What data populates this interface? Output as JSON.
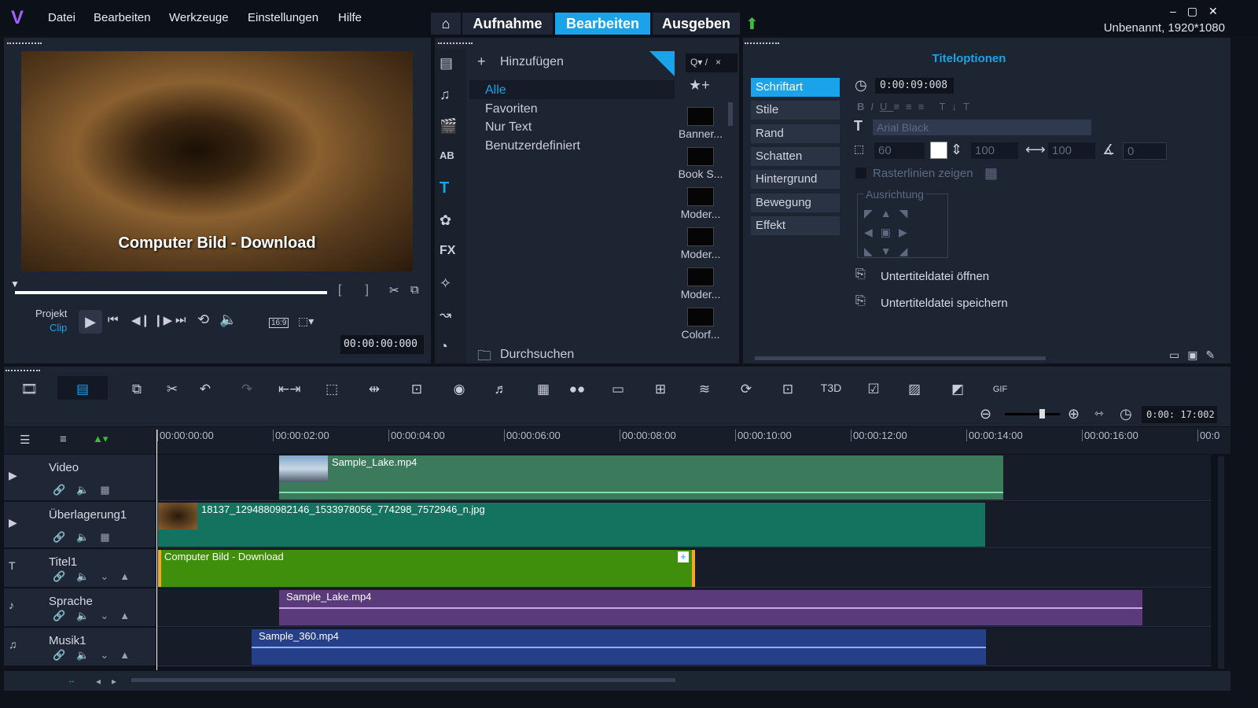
{
  "menubar": {
    "items": [
      "Datei",
      "Bearbeiten",
      "Werkzeuge",
      "Einstellungen",
      "Hilfe"
    ],
    "tabs": [
      "Aufnahme",
      "Bearbeiten",
      "Ausgeben"
    ],
    "active_tab": "Bearbeiten",
    "project_info": "Unbenannt, 1920*1080"
  },
  "preview": {
    "overlay_text": "Computer Bild - Download",
    "mode_project": "Projekt",
    "mode_clip": "Clip",
    "aspect": "16:9",
    "timecode": "00:00:00:000"
  },
  "library": {
    "add_label": "Hinzufügen",
    "filters": [
      "Alle",
      "Favoriten",
      "Nur Text",
      "Benutzerdefiniert"
    ],
    "selected_filter": "Alle",
    "browse_label": "Durchsuchen",
    "fx_label": "FX",
    "templates": [
      "Banner...",
      "Book S...",
      "Moder...",
      "Moder...",
      "Moder...",
      "Colorf..."
    ]
  },
  "title_options": {
    "heading": "Titeloptionen",
    "tabs": [
      "Schriftart",
      "Stile",
      "Rand",
      "Schatten",
      "Hintergrund",
      "Bewegung",
      "Effekt"
    ],
    "active_tab": "Schriftart",
    "duration": "0:00:09:008",
    "font": "Arial Black",
    "font_size": "60",
    "line_spacing": "100",
    "char_spacing": "100",
    "angle": "0",
    "grid_label": "Rasterlinien zeigen",
    "alignment_label": "Ausrichtung",
    "open_subtitle": "Untertiteldatei öffnen",
    "save_subtitle": "Untertiteldatei speichern",
    "accent": "#1aa3e8"
  },
  "timeline": {
    "duration": "0:00: 17:002",
    "ruler": [
      "00:00:00:00",
      "00:00:02:00",
      "00:00:04:00",
      "00:00:06:00",
      "00:00:08:00",
      "00:00:10:00",
      "00:00:12:00",
      "00:00:14:00",
      "00:00:16:00",
      "00:0"
    ],
    "tracks": [
      {
        "name": "Video"
      },
      {
        "name": "Überlagerung1"
      },
      {
        "name": "Titel1"
      },
      {
        "name": "Sprache"
      },
      {
        "name": "Musik1"
      }
    ],
    "clips": {
      "video": "Sample_Lake.mp4",
      "overlay": "18137_1294880982146_1533978056_774298_7572946_n.jpg",
      "title": "Computer Bild - Download",
      "voice": "Sample_Lake.mp4",
      "music": "Sample_360.mp4"
    }
  }
}
